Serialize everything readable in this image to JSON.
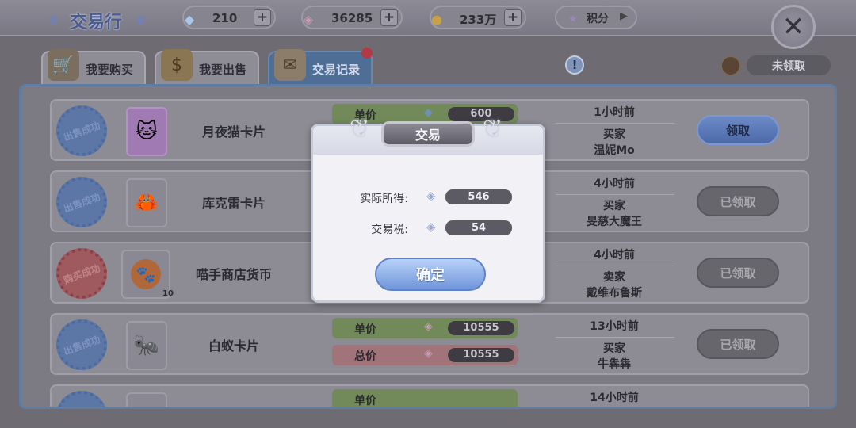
{
  "header": {
    "title": "交易行",
    "currencies": [
      {
        "icon": "diamond-icon",
        "value": "210"
      },
      {
        "icon": "crystal-icon",
        "value": "36285"
      },
      {
        "icon": "gold-coin-icon",
        "value": "233万"
      },
      {
        "icon": "star-icon",
        "value": "积分"
      }
    ]
  },
  "tabs": [
    {
      "label": "我要购买",
      "icon": "shopping-cart-icon",
      "active": false
    },
    {
      "label": "我要出售",
      "icon": "money-bag-icon",
      "active": false
    },
    {
      "label": "交易记录",
      "icon": "scroll-icon",
      "active": true
    }
  ],
  "unclaimed_label": "未领取",
  "records": [
    {
      "stamp": "出售成功",
      "stamp_type": "sell",
      "icon": "cat-card-icon",
      "name": "月夜猫卡片",
      "unit_label": "单价",
      "unit_price": "600",
      "time": "1小时前",
      "role": "买家",
      "counterparty": "温妮Mo",
      "button": "领取",
      "claimable": true
    },
    {
      "stamp": "出售成功",
      "stamp_type": "sell",
      "icon": "crab-card-icon",
      "name": "库克雷卡片",
      "time": "4小时前",
      "role": "买家",
      "counterparty": "旻慈大魔王",
      "button": "已领取",
      "claimable": false
    },
    {
      "stamp": "购买成功",
      "stamp_type": "buy",
      "icon": "paw-coin-icon",
      "name": "喵手商店货币",
      "quantity": "10",
      "time": "4小时前",
      "role": "卖家",
      "counterparty": "戴维布鲁斯",
      "button": "已领取",
      "claimable": false
    },
    {
      "stamp": "出售成功",
      "stamp_type": "sell",
      "icon": "ant-card-icon",
      "name": "白蚁卡片",
      "unit_label": "单价",
      "unit_price": "10555",
      "total_label": "总价",
      "total_price": "10555",
      "time": "13小时前",
      "role": "买家",
      "counterparty": "牛犇犇",
      "button": "已领取",
      "claimable": false
    },
    {
      "stamp": "出售成功",
      "stamp_type": "sell",
      "icon": "card-icon",
      "unit_label": "单价",
      "time": "14小时前"
    }
  ],
  "dialog": {
    "title": "交易",
    "income_label": "实际所得:",
    "income_value": "546",
    "tax_label": "交易税:",
    "tax_value": "54",
    "confirm_label": "确定"
  }
}
